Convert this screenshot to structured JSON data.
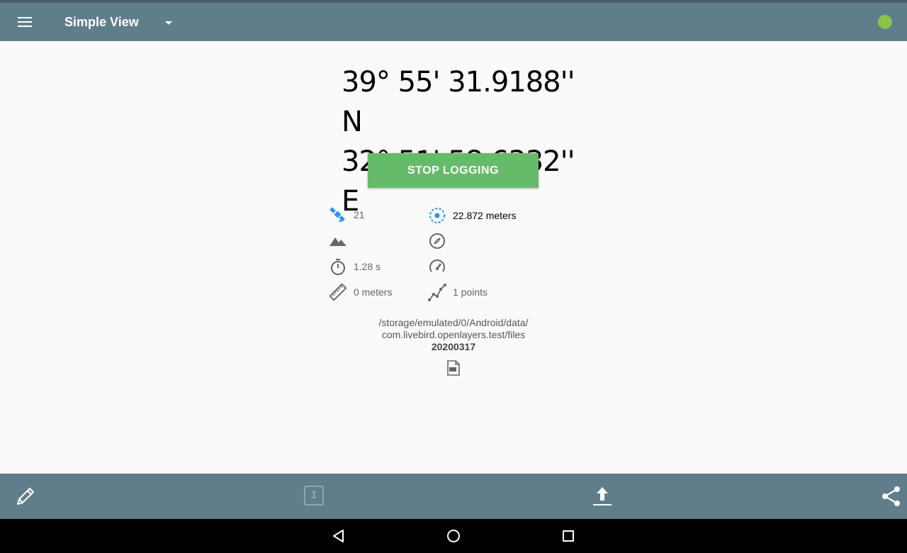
{
  "app_bar": {
    "title": "Simple View",
    "menu_icon": "hamburger-menu-icon",
    "dropdown_icon": "dropdown-arrow-icon",
    "status_color": "#8bc34a"
  },
  "location": {
    "latitude": "39° 55' 31.9188'' N",
    "longitude": "32° 51' 58.6332'' E"
  },
  "logging_button": {
    "label": "STOP LOGGING",
    "color": "#66bb6a"
  },
  "stats": {
    "satellites": "21",
    "accuracy": "22.872 meters",
    "altitude": "",
    "bearing": "",
    "duration": "1.28 s",
    "speed": "",
    "distance": "0 meters",
    "points": "1 points"
  },
  "file": {
    "path_line1": "/storage/emulated/0/Android/data/",
    "path_line2": "com.livebird.openlayers.test/files",
    "name": "20200317"
  },
  "bottom_bar": {
    "badge_number": "1",
    "icons": [
      "pencil-icon",
      "one-badge-icon",
      "upload-icon",
      "share-icon"
    ]
  },
  "colors": {
    "primary": "#607d8b",
    "accent": "#66bb6a",
    "icon_blue": "#2196f3"
  }
}
